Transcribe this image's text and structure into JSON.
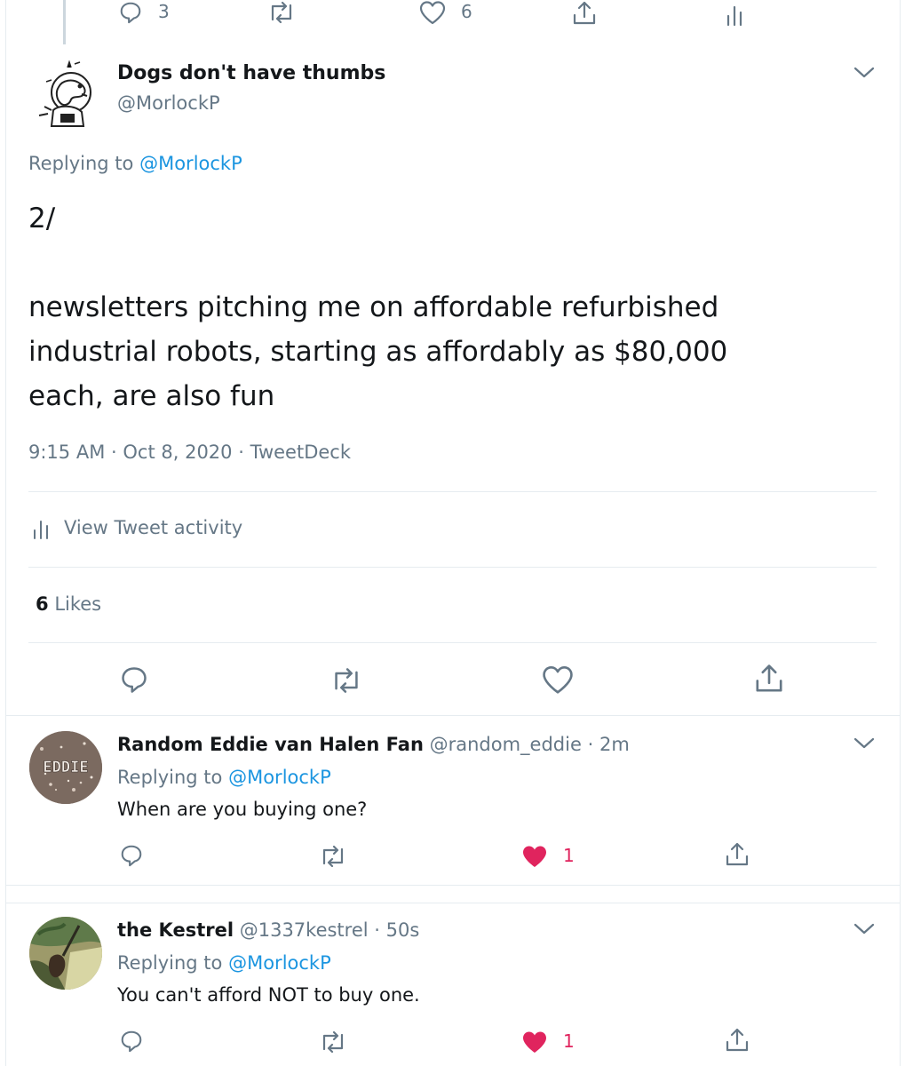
{
  "top_actions": {
    "reply_count": "3",
    "like_count": "6"
  },
  "main_tweet": {
    "display_name": "Dogs don't have thumbs",
    "handle": "@MorlockP",
    "replying_prefix": "Replying to",
    "replying_to": "@MorlockP",
    "text_line1": "2/",
    "text_line2": "newsletters pitching me on affordable refurbished",
    "text_line3": "industrial robots, starting as affordably as $80,000",
    "text_line4": "each, are also fun",
    "time": "9:15 AM",
    "dot1": "·",
    "date": "Oct 8, 2020",
    "dot2": "·",
    "source": "TweetDeck",
    "activity_label": "View Tweet activity",
    "likes_count": "6",
    "likes_label": "Likes"
  },
  "replies": [
    {
      "display_name": "Random Eddie van Halen Fan",
      "handle": "@random_eddie",
      "dot": "·",
      "time": "2m",
      "replying_prefix": "Replying to",
      "replying_to": "@MorlockP",
      "text": "When are you buying one?",
      "like_count": "1",
      "avatar_text": "EDDIE"
    },
    {
      "display_name": "the Kestrel",
      "handle": "@1337kestrel",
      "dot": "·",
      "time": "50s",
      "replying_prefix": "Replying to",
      "replying_to": "@MorlockP",
      "text": "You can't afford NOT to buy one.",
      "like_count": "1"
    }
  ],
  "colors": {
    "accent": "#1b95e0",
    "muted": "#657786",
    "like": "#e0245e",
    "border": "#e6ecf0"
  },
  "icons": [
    "reply-icon",
    "retweet-icon",
    "like-icon",
    "share-icon",
    "analytics-icon",
    "chevron-down-icon"
  ]
}
